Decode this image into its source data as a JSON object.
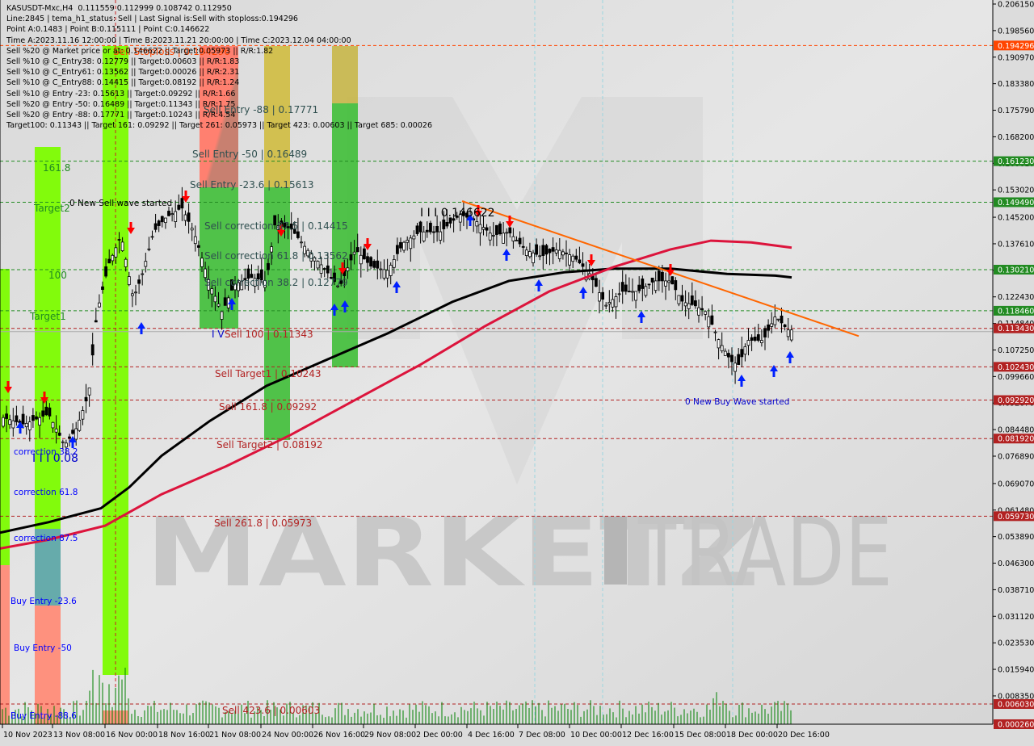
{
  "window": {
    "symbol_header": "KASUSDT-Mxc,H4  0.111559 0.112999 0.108742 0.112950"
  },
  "info_lines": [
    "KASUSDT-Mxc,H4  0.111559 0.112999 0.108742 0.112950",
    "Line:2845 | tema_h1_status: Sell | Last Signal is:Sell with stoploss:0.194296",
    "Point A:0.1483 | Point B:0.115111 | Point C:0.146622",
    "Time A:2023.11.16 12:00:00 | Time B:2023.11.21 20:00:00 | Time C:2023.12.04 04:00:00",
    "Sell %20 @ Market price or at: 0.146622 || Target:0.05973 || R/R:1.82",
    "Sell %10 @ C_Entry38: 0.12779 || Target:0.00603 || R/R:1.83",
    "Sell %10 @ C_Entry61: 0.13562 || Target:0.00026 || R/R:2.31",
    "Sell %10 @ C_Entry88: 0.14415 || Target:0.08192 || R/R:1.24",
    "Sell %10 @ Entry -23: 0.15613 || Target:0.09292 || R/R:1.66",
    "Sell %20 @ Entry -50: 0.16489 || Target:0.11343 || R/R:1.75",
    "Sell %20 @ Entry -88: 0.17771 || Target:0.10243 || R/R:4.54",
    "Target100: 0.11343 || Target 161: 0.09292 || Target 261: 0.05973 || Target 423: 0.00603 || Target 685: 0.00026"
  ],
  "chart_data": {
    "type": "candlestick",
    "symbol": "KASUSDT-Mxc",
    "timeframe": "H4",
    "ohlc_last": {
      "open": 0.111559,
      "high": 0.112999,
      "low": 0.108742,
      "close": 0.11295
    },
    "ylim": [
      0.00026,
      0.20615
    ],
    "y_ticks": [
      "0.206150",
      "0.198560",
      "0.190970",
      "0.183380",
      "0.175790",
      "0.168200",
      "0.160610",
      "0.153020",
      "0.145200",
      "0.137610",
      "0.130020",
      "0.122430",
      "0.114840",
      "0.107250",
      "0.099660",
      "0.092070",
      "0.084480",
      "0.076890",
      "0.069070",
      "0.061480",
      "0.053890",
      "0.046300",
      "0.038710",
      "0.031120",
      "0.023530",
      "0.015940",
      "0.008350"
    ],
    "x_ticks": [
      "10 Nov 2023",
      "13 Nov 08:00",
      "16 Nov 00:00",
      "18 Nov 16:00",
      "21 Nov 08:00",
      "24 Nov 00:00",
      "26 Nov 16:00",
      "29 Nov 08:00",
      "2 Dec 00:00",
      "4 Dec 16:00",
      "7 Dec 08:00",
      "10 Dec 00:00",
      "12 Dec 16:00",
      "15 Dec 08:00",
      "18 Dec 00:00",
      "20 Dec 16:00"
    ],
    "price_tags": [
      {
        "value": "0.194296",
        "color": "#ff4500"
      },
      {
        "value": "0.161230",
        "color": "#228b22"
      },
      {
        "value": "0.149490",
        "color": "#228b22"
      },
      {
        "value": "0.130210",
        "color": "#228b22"
      },
      {
        "value": "0.118460",
        "color": "#228b22"
      },
      {
        "value": "0.113430",
        "color": "#b22222"
      },
      {
        "value": "0.102430",
        "color": "#b22222"
      },
      {
        "value": "0.092920",
        "color": "#b22222"
      },
      {
        "value": "0.081920",
        "color": "#b22222"
      },
      {
        "value": "0.059730",
        "color": "#b22222"
      },
      {
        "value": "0.006030",
        "color": "#b22222"
      },
      {
        "value": "0.000260",
        "color": "#b22222"
      }
    ],
    "levels": [
      {
        "label": "Sell Stoploss | 0.194296",
        "price": 0.194296,
        "color": "#ff4500",
        "style": "dashed"
      },
      {
        "label": "Sell Entry -88 | 0.17771",
        "price": 0.17771,
        "color": "#2f4f4f"
      },
      {
        "label": "Sell Entry -50 | 0.16489",
        "price": 0.16489,
        "color": "#2f4f4f"
      },
      {
        "label": "Sell Entry -23.6 | 0.15613",
        "price": 0.15613,
        "color": "#2f4f4f"
      },
      {
        "label": "Sell correction 87.5 | 0.14415",
        "price": 0.14415,
        "color": "#2f4f4f"
      },
      {
        "label": "Sell correction 61.8 | 0.13562",
        "price": 0.13562,
        "color": "#2f4f4f"
      },
      {
        "label": "Sell correction 38.2 | 0.12779",
        "price": 0.12779,
        "color": "#2f4f4f"
      },
      {
        "label": "Sell 100 | 0.11343",
        "price": 0.11343,
        "color": "#b22222"
      },
      {
        "label": "Sell Target1 | 0.10243",
        "price": 0.10243,
        "color": "#b22222"
      },
      {
        "label": "Sell 161.8 | 0.09292",
        "price": 0.09292,
        "color": "#b22222"
      },
      {
        "label": "Sell Target2 | 0.08192",
        "price": 0.08192,
        "color": "#b22222"
      },
      {
        "label": "Sell  261.8 | 0.05973",
        "price": 0.05973,
        "color": "#b22222"
      },
      {
        "label": "Sell  423.6 | 0.00603",
        "price": 0.00603,
        "color": "#b22222"
      }
    ],
    "left_labels": [
      {
        "label": "161.8",
        "color": "#228b22"
      },
      {
        "label": "Target2",
        "color": "#228b22"
      },
      {
        "label": "100",
        "color": "#228b22"
      },
      {
        "label": "Target1",
        "color": "#228b22"
      },
      {
        "label": "correction 38.2",
        "color": "#0000ff"
      },
      {
        "label": "correction 61.8",
        "color": "#0000ff"
      },
      {
        "label": "correction 87.5",
        "color": "#0000ff"
      },
      {
        "label": "Buy Entry -23.6",
        "color": "#0000ff"
      },
      {
        "label": "Buy Entry -50",
        "color": "#0000ff"
      },
      {
        "label": "Buy Entry -88.6",
        "color": "#0000ff"
      }
    ],
    "annotations": {
      "new_sell_wave": "0 New Sell wave started",
      "new_buy_wave": "0 New Buy Wave started",
      "point_c": "I I I 0.146622",
      "point_low": "I I I 0.08",
      "point_b": "I V"
    },
    "moving_averages": [
      {
        "name": "MA black",
        "color": "#000000",
        "points": [
          [
            0,
            0.055
          ],
          [
            60,
            0.058
          ],
          [
            125,
            0.062
          ],
          [
            160,
            0.068
          ],
          [
            200,
            0.077
          ],
          [
            260,
            0.087
          ],
          [
            330,
            0.097
          ],
          [
            400,
            0.104
          ],
          [
            480,
            0.112
          ],
          [
            560,
            0.121
          ],
          [
            630,
            0.127
          ],
          [
            700,
            0.1295
          ],
          [
            760,
            0.1305
          ],
          [
            830,
            0.1305
          ],
          [
            900,
            0.129
          ],
          [
            960,
            0.1285
          ],
          [
            980,
            0.128
          ]
        ]
      },
      {
        "name": "MA crimson",
        "color": "#dc143c",
        "points": [
          [
            0,
            0.0505
          ],
          [
            60,
            0.053
          ],
          [
            130,
            0.057
          ],
          [
            200,
            0.066
          ],
          [
            280,
            0.074
          ],
          [
            360,
            0.083
          ],
          [
            440,
            0.093
          ],
          [
            520,
            0.103
          ],
          [
            600,
            0.114
          ],
          [
            680,
            0.124
          ],
          [
            760,
            0.131
          ],
          [
            830,
            0.136
          ],
          [
            880,
            0.1385
          ],
          [
            930,
            0.138
          ],
          [
            980,
            0.1365
          ]
        ]
      }
    ],
    "trend_line": {
      "color": "#ff6600",
      "from": [
        572,
        0.1498
      ],
      "to": [
        1063,
        0.1112
      ]
    },
    "watermark": "MARKETZ TRADE"
  }
}
